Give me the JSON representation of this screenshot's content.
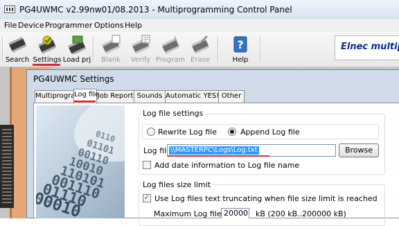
{
  "window": {
    "title": "PG4UWMC v2.99nw01/08.2013 - Multiprogramming Control Panel"
  },
  "menu": {
    "file": "File",
    "device": "Device",
    "programmer": "Programmer",
    "options": "Options",
    "help": "Help"
  },
  "toolbar": {
    "buttons": [
      {
        "label": "Search",
        "icon": "search-chip-icon",
        "enabled": true
      },
      {
        "label": "Settings",
        "icon": "settings-chip-icon",
        "enabled": true
      },
      {
        "label": "Load prj",
        "icon": "load-project-icon",
        "enabled": true
      },
      {
        "label": "Blank",
        "icon": "blank-chip-icon",
        "enabled": false
      },
      {
        "label": "Verify",
        "icon": "verify-chip-icon",
        "enabled": false
      },
      {
        "label": "Program",
        "icon": "program-chip-icon",
        "enabled": false
      },
      {
        "label": "Erase",
        "icon": "erase-chip-icon",
        "enabled": false
      },
      {
        "label": "Help",
        "icon": "help-icon",
        "enabled": true
      }
    ],
    "brand": "Elnec multiprogrammin"
  },
  "dialog": {
    "title": "PG4UWMC Settings",
    "tabs": [
      "Multiprogramming",
      "Log file",
      "Job Report",
      "Sounds",
      "Automatic YES!",
      "Other"
    ],
    "active_tab": "Log file",
    "decoration_rows": [
      "0110",
      "01101",
      "00110",
      "10010",
      "110101",
      "001110",
      "01110",
      "00010"
    ],
    "log_settings": {
      "group_label": "Log file settings",
      "rewrite_label": "Rewrite Log file",
      "append_label": "Append Log file",
      "selected_mode": "append",
      "log_file_label": "Log file:",
      "log_file_value": "\\\\MASTERPC\\Logs\\Log.txt",
      "browse_label": "Browse",
      "add_date_label": "Add date information to Log file name",
      "add_date_checked": false
    },
    "size_limit": {
      "group_label": "Log files size limit",
      "use_truncating_label": "Use Log files text truncating when file size limit is reached",
      "use_truncating_checked": true,
      "max_size_label": "Maximum Log file size:",
      "max_size_value": "20000",
      "max_size_units": "kB  (200 kB..200000 kB)"
    }
  },
  "accent": {
    "underline": "#e0282c",
    "selection": "#3399ff",
    "brand": "#0a2b8c"
  }
}
